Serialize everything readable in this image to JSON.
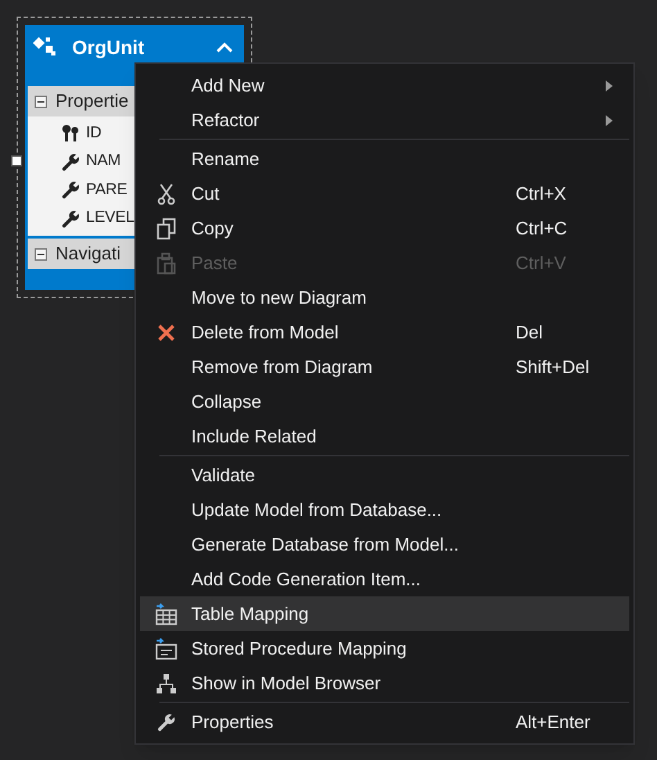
{
  "entity": {
    "title": "OrgUnit",
    "expanded": true,
    "sections": [
      {
        "label": "Propertie",
        "expanded": true,
        "properties": [
          {
            "kind": "key",
            "name": "ID"
          },
          {
            "kind": "scalar",
            "name": "NAM"
          },
          {
            "kind": "scalar",
            "name": "PARE"
          },
          {
            "kind": "scalar",
            "name": "LEVEL"
          }
        ]
      },
      {
        "label": "Navigati",
        "expanded": true
      }
    ]
  },
  "context_menu": [
    {
      "kind": "item",
      "label": "Add New",
      "submenu": true,
      "disabled": false,
      "selected": false
    },
    {
      "kind": "item",
      "label": "Refactor",
      "submenu": true,
      "disabled": false,
      "selected": false
    },
    {
      "kind": "separator"
    },
    {
      "kind": "item",
      "label": "Rename",
      "disabled": false,
      "selected": false
    },
    {
      "kind": "item",
      "label": "Cut",
      "shortcut": "Ctrl+X",
      "disabled": false,
      "selected": false
    },
    {
      "kind": "item",
      "label": "Copy",
      "shortcut": "Ctrl+C",
      "disabled": false,
      "selected": false
    },
    {
      "kind": "item",
      "label": "Paste",
      "shortcut": "Ctrl+V",
      "disabled": true,
      "selected": false
    },
    {
      "kind": "item",
      "label": "Move to new Diagram",
      "disabled": false,
      "selected": false
    },
    {
      "kind": "item",
      "label": "Delete from Model",
      "shortcut": "Del",
      "disabled": false,
      "selected": false
    },
    {
      "kind": "item",
      "label": "Remove from Diagram",
      "shortcut": "Shift+Del",
      "disabled": false,
      "selected": false
    },
    {
      "kind": "item",
      "label": "Collapse",
      "disabled": false,
      "selected": false
    },
    {
      "kind": "item",
      "label": "Include Related",
      "disabled": false,
      "selected": false
    },
    {
      "kind": "separator"
    },
    {
      "kind": "item",
      "label": "Validate",
      "disabled": false,
      "selected": false
    },
    {
      "kind": "item",
      "label": "Update Model from Database...",
      "disabled": false,
      "selected": false
    },
    {
      "kind": "item",
      "label": "Generate Database from Model...",
      "disabled": false,
      "selected": false
    },
    {
      "kind": "item",
      "label": "Add Code Generation Item...",
      "disabled": false,
      "selected": false
    },
    {
      "kind": "item",
      "label": "Table Mapping",
      "disabled": false,
      "selected": true
    },
    {
      "kind": "item",
      "label": "Stored Procedure Mapping",
      "disabled": false,
      "selected": false
    },
    {
      "kind": "item",
      "label": "Show in Model Browser",
      "disabled": false,
      "selected": false
    },
    {
      "kind": "separator"
    },
    {
      "kind": "item",
      "label": "Properties",
      "shortcut": "Alt+Enter",
      "disabled": false,
      "selected": false
    }
  ]
}
